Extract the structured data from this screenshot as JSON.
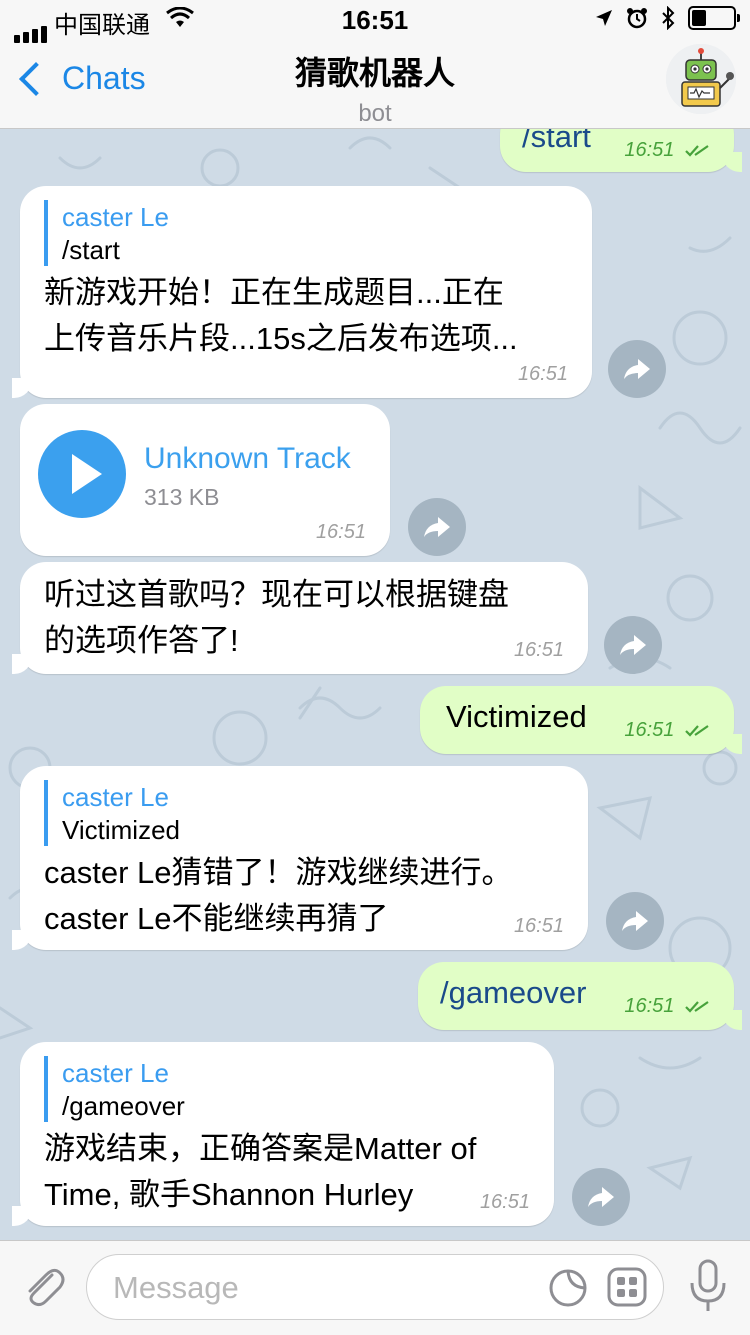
{
  "status_bar": {
    "carrier": "中国联通",
    "time": "16:51",
    "icons": [
      "signal-icon",
      "wifi-icon",
      "location-icon",
      "alarm-icon",
      "bluetooth-icon",
      "battery-icon"
    ]
  },
  "header": {
    "back_label": "Chats",
    "title": "猜歌机器人",
    "subtitle": "bot",
    "avatar": "robot-avatar"
  },
  "messages": [
    {
      "direction": "out",
      "text": "/start",
      "time": "16:51",
      "read": true
    },
    {
      "direction": "in",
      "reply_name": "caster Le",
      "reply_text": "/start",
      "text": "新游戏开始！正在生成题目...正在\n上传音乐片段...15s之后发布选项...",
      "time": "16:51"
    },
    {
      "direction": "in",
      "type": "audio",
      "title": "Unknown Track",
      "size": "313 KB",
      "time": "16:51"
    },
    {
      "direction": "in",
      "text": "听过这首歌吗？现在可以根据键盘\n的选项作答了!",
      "time": "16:51"
    },
    {
      "direction": "out",
      "text": "Victimized",
      "time": "16:51",
      "read": true
    },
    {
      "direction": "in",
      "reply_name": "caster Le",
      "reply_text": "Victimized",
      "text": "caster Le猜错了！游戏继续进行。\ncaster Le不能继续再猜了",
      "time": "16:51"
    },
    {
      "direction": "out",
      "text": "/gameover",
      "time": "16:51",
      "read": true
    },
    {
      "direction": "in",
      "reply_name": "caster Le",
      "reply_text": "/gameover",
      "text": "游戏结束，正确答案是Matter of\nTime, 歌手Shannon Hurley",
      "time": "16:51"
    }
  ],
  "input": {
    "placeholder": "Message",
    "icons": [
      "paperclip-icon",
      "sticker-icon",
      "bot-keyboard-icon",
      "microphone-icon"
    ]
  },
  "colors": {
    "accent": "#1b87e6",
    "incoming_bubble": "#ffffff",
    "outgoing_bubble": "#e1fec6",
    "read_check": "#47a23b",
    "wallpaper": "#cfdbe6"
  }
}
